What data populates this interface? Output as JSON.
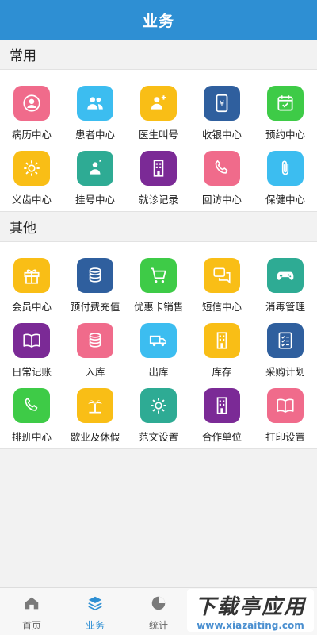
{
  "header": {
    "title": "业务"
  },
  "sections": [
    {
      "title": "常用",
      "items": [
        {
          "label": "病历中心",
          "icon": "person-circle-icon",
          "color": "#f06b8b"
        },
        {
          "label": "患者中心",
          "icon": "people-icon",
          "color": "#3cbdf0"
        },
        {
          "label": "医生叫号",
          "icon": "doctor-call-icon",
          "color": "#f9be16"
        },
        {
          "label": "收银中心",
          "icon": "cashier-phone-icon",
          "color": "#2f5f9e"
        },
        {
          "label": "预约中心",
          "icon": "calendar-check-icon",
          "color": "#3ecb47"
        },
        {
          "label": "义齿中心",
          "icon": "gear-icon",
          "color": "#f9be16"
        },
        {
          "label": "挂号中心",
          "icon": "register-person-icon",
          "color": "#2eab94"
        },
        {
          "label": "就诊记录",
          "icon": "building-icon",
          "color": "#7b2a96"
        },
        {
          "label": "回访中心",
          "icon": "phone-icon",
          "color": "#f06b8b"
        },
        {
          "label": "保健中心",
          "icon": "paperclip-icon",
          "color": "#3cbdf0"
        }
      ]
    },
    {
      "title": "其他",
      "items": [
        {
          "label": "会员中心",
          "icon": "gift-icon",
          "color": "#f9be16"
        },
        {
          "label": "预付费充值",
          "icon": "coins-icon",
          "color": "#2f5f9e"
        },
        {
          "label": "优惠卡销售",
          "icon": "cart-icon",
          "color": "#3ecb47"
        },
        {
          "label": "短信中心",
          "icon": "chat-icon",
          "color": "#f9be16"
        },
        {
          "label": "消毒管理",
          "icon": "gamepad-icon",
          "color": "#2eab94"
        },
        {
          "label": "日常记账",
          "icon": "book-icon",
          "color": "#7b2a96"
        },
        {
          "label": "入库",
          "icon": "coins-icon",
          "color": "#f06b8b"
        },
        {
          "label": "出库",
          "icon": "truck-icon",
          "color": "#3cbdf0"
        },
        {
          "label": "库存",
          "icon": "building-icon",
          "color": "#f9be16"
        },
        {
          "label": "采购计划",
          "icon": "checklist-icon",
          "color": "#2f5f9e"
        },
        {
          "label": "排班中心",
          "icon": "phone-icon",
          "color": "#3ecb47"
        },
        {
          "label": "歇业及休假",
          "icon": "palm-tree-icon",
          "color": "#f9be16"
        },
        {
          "label": "范文设置",
          "icon": "gear-icon",
          "color": "#2eab94"
        },
        {
          "label": "合作单位",
          "icon": "building-icon",
          "color": "#7b2a96"
        },
        {
          "label": "打印设置",
          "icon": "book-icon",
          "color": "#f06b8b"
        }
      ]
    }
  ],
  "tabbar": [
    {
      "label": "首页",
      "icon": "home-icon",
      "active": false
    },
    {
      "label": "业务",
      "icon": "layers-icon",
      "active": true
    },
    {
      "label": "统计",
      "icon": "pie-chart-icon",
      "active": false
    }
  ],
  "watermark": {
    "main": "下载亭应用",
    "url": "www.xiazaiting.com"
  }
}
